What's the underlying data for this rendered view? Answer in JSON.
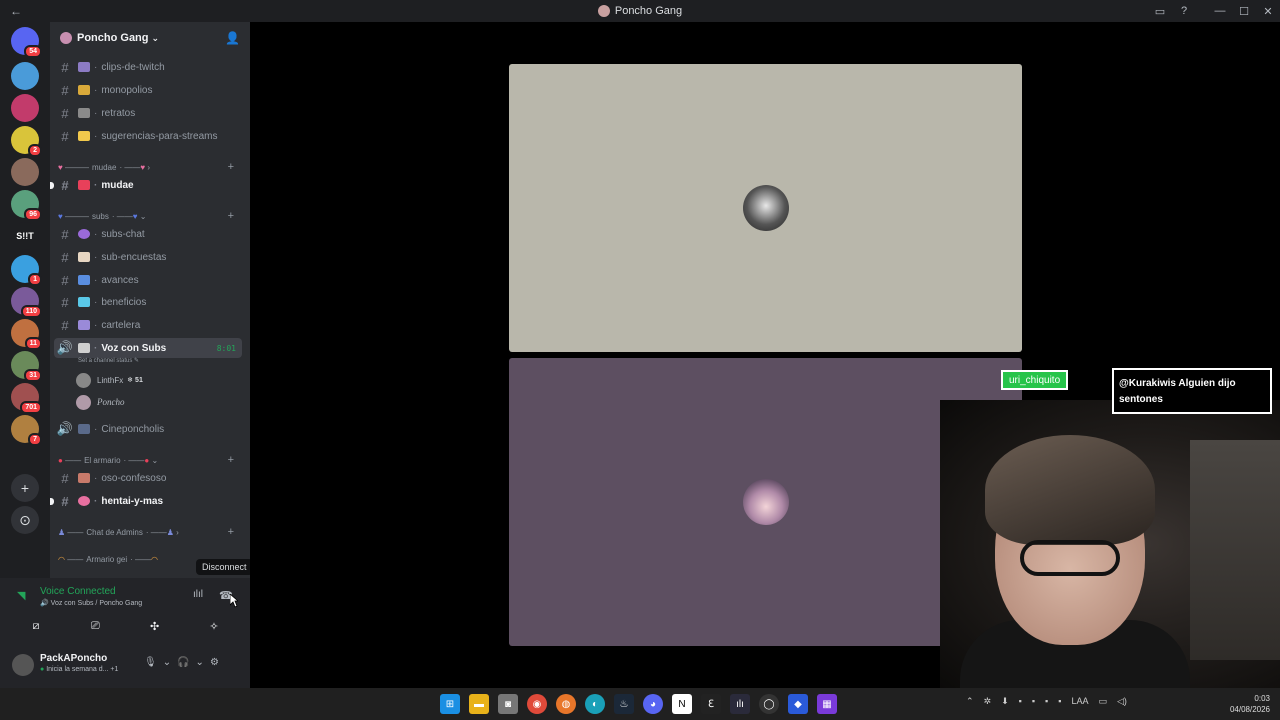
{
  "window": {
    "title": "Poncho Gang"
  },
  "servers": [
    {
      "badge": "54",
      "color": "#5865f2"
    },
    {
      "badge": "",
      "color": "#4a9bd9"
    },
    {
      "badge": "",
      "color": "#c23b6b"
    },
    {
      "badge": "2",
      "color": "#d9c43a"
    },
    {
      "badge": "",
      "color": "#8a6a5c"
    },
    {
      "badge": "96",
      "color": "#5aa07d"
    },
    {
      "badge": "",
      "color": "#1e1f22",
      "label": "S!!T"
    },
    {
      "badge": "1",
      "color": "#3aa0e0"
    },
    {
      "badge": "110",
      "color": "#7a5a9a"
    },
    {
      "badge": "11",
      "color": "#c07040"
    },
    {
      "badge": "31",
      "color": "#6a8a5a"
    },
    {
      "badge": "701",
      "color": "#a05050"
    },
    {
      "badge": "7",
      "color": "#b08040"
    }
  ],
  "guild": {
    "name": "Poncho Gang"
  },
  "channels": {
    "clips": "clips-de-twitch",
    "monopolios": "monopolios",
    "retratos": "retratos",
    "sugerencias": "sugerencias-para-streams",
    "cat_mudae": "mudae",
    "mudae": "mudae",
    "cat_subs": "subs",
    "subs_chat": "subs-chat",
    "sub_encuestas": "sub-encuestas",
    "avances": "avances",
    "beneficios": "beneficios",
    "cartelera": "cartelera",
    "voz_subs": "Voz con Subs",
    "voz_timer": "8:01",
    "voz_status": "Set a channel status",
    "voice_user1": "LinthFx",
    "voice_user1_tag": "51",
    "voice_user2": "Poncho",
    "cineponcholis": "Cineponcholis",
    "cat_armario": "El armario",
    "oso": "oso-confesoso",
    "hentai": "hentai-y-mas",
    "cat_admins": "Chat de Admins",
    "cat_armario_gei": "Armario gei"
  },
  "voice": {
    "title": "Voice Connected",
    "sub": "Voz con Subs / Poncho Gang",
    "tooltip": "Disconnect"
  },
  "user": {
    "name": "PackAPoncho",
    "status": "Inicia la semana d...",
    "extra": "+1"
  },
  "overlay": {
    "chat_user": "uri_chiquito",
    "chat_msg": "@Kurakiwis Alguien dijo sentones"
  },
  "taskbar": {
    "lang": "LAA",
    "time": "0:03",
    "date": "04/08/2026"
  }
}
